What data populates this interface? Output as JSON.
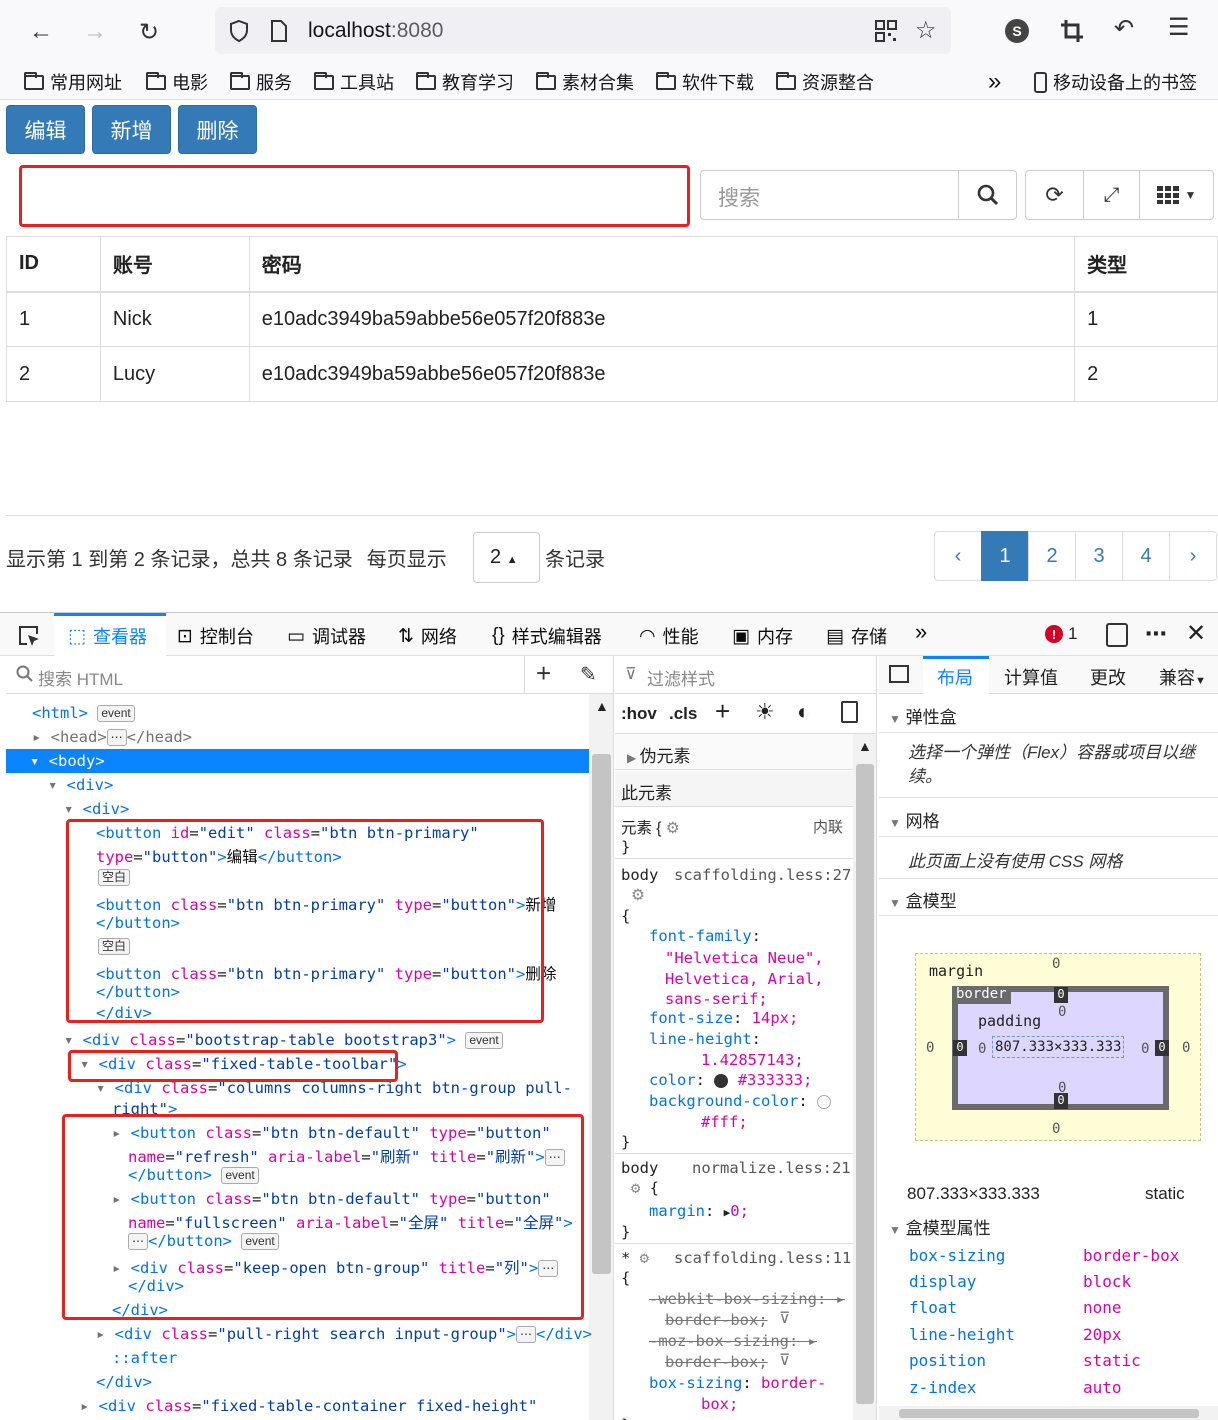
{
  "browser": {
    "url_host": "localhost",
    "url_port": ":8080",
    "profile_initial": "S",
    "bookmarks": [
      "常用网址",
      "电影",
      "服务",
      "工具站",
      "教育学习",
      "素材合集",
      "软件下载",
      "资源整合"
    ],
    "mobile_bookmarks": "移动设备上的书签",
    "overflow": "»"
  },
  "page": {
    "buttons": {
      "edit": "编辑",
      "add": "新增",
      "delete": "删除"
    },
    "search_placeholder": "搜索",
    "table": {
      "headers": [
        "ID",
        "账号",
        "密码",
        "类型"
      ],
      "rows": [
        [
          "1",
          "Nick",
          "e10adc3949ba59abbe56e057f20f883e",
          "1"
        ],
        [
          "2",
          "Lucy",
          "e10adc3949ba59abbe56e057f20f883e",
          "2"
        ]
      ]
    },
    "pagination": {
      "info": "显示第 1 到第 2 条记录，总共 8 条记录",
      "per_page_prefix": "每页显示",
      "page_size": "2",
      "per_page_suffix": "条记录",
      "prev": "‹",
      "pages": [
        "1",
        "2",
        "3",
        "4"
      ],
      "next": "›",
      "active_page": "1"
    }
  },
  "devtools": {
    "tabs": {
      "inspector": "查看器",
      "console": "控制台",
      "debugger": "调试器",
      "network": "网络",
      "style_editor": "样式编辑器",
      "performance": "性能",
      "memory": "内存",
      "storage": "存储"
    },
    "error_count": "1",
    "search_html_placeholder": "搜索 HTML",
    "filter_styles_placeholder": "过滤样式",
    "hov": ":hov",
    "cls": ".cls",
    "pseudo_elements": "伪元素",
    "this_element": "此元素",
    "element_rule": "元素 {",
    "inline": "内联",
    "rules": {
      "body1_source": "scaffolding.less:27",
      "body2_source": "normalize.less:21",
      "star_source": "scaffolding.less:11",
      "font_family_value": "\"Helvetica Neue\", Helvetica, Arial, sans-serif;",
      "font_size": "14px;",
      "line_height": "1.42857143;",
      "color": "#333333;",
      "background_color": "#fff;",
      "margin": "0;",
      "box_sizing": "border-box;"
    },
    "layout_tabs": {
      "layout": "布局",
      "computed": "计算值",
      "changes": "更改",
      "compat": "兼容"
    },
    "flexbox": "弹性盒",
    "flexbox_hint": "选择一个弹性（Flex）容器或项目以继续。",
    "grid": "网格",
    "grid_hint": "此页面上没有使用 CSS 网格",
    "box_model": "盒模型",
    "box_model_props_title": "盒模型属性",
    "box_dimensions": "807.333×333.333",
    "box_position": "static",
    "box_labels": {
      "margin": "margin",
      "border": "border",
      "padding": "padding",
      "zero": "0"
    },
    "box_props": [
      [
        "box-sizing",
        "border-box"
      ],
      [
        "display",
        "block"
      ],
      [
        "float",
        "none"
      ],
      [
        "line-height",
        "20px"
      ],
      [
        "position",
        "static"
      ],
      [
        "z-index",
        "auto"
      ]
    ],
    "markup": {
      "whitespace": "空白",
      "event": "event",
      "after": "::after"
    }
  }
}
